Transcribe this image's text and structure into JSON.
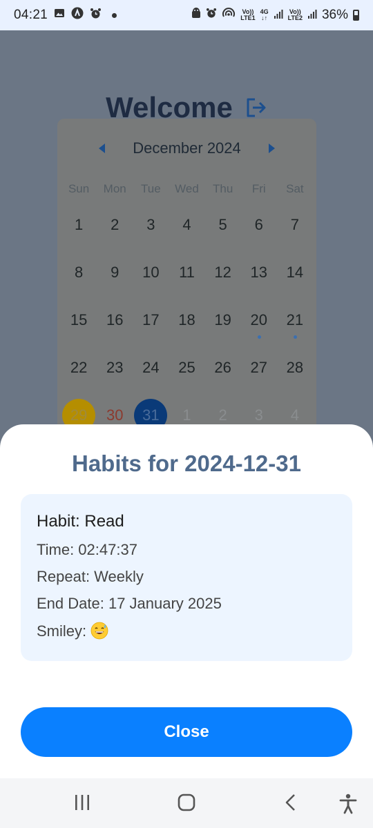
{
  "status_bar": {
    "time": "04:21",
    "volte1_label": "Vo))",
    "lte1_label": "LTE1",
    "network_4g_label": "4G",
    "volte2_label": "Vo))",
    "lte2_label": "LTE2",
    "battery_percent": "36%"
  },
  "header": {
    "title": "Welcome"
  },
  "calendar": {
    "month_label": "December 2024",
    "weekdays": [
      "Sun",
      "Mon",
      "Tue",
      "Wed",
      "Thu",
      "Fri",
      "Sat"
    ],
    "days": [
      {
        "label": "1"
      },
      {
        "label": "2"
      },
      {
        "label": "3"
      },
      {
        "label": "4"
      },
      {
        "label": "5"
      },
      {
        "label": "6"
      },
      {
        "label": "7"
      },
      {
        "label": "8"
      },
      {
        "label": "9"
      },
      {
        "label": "10"
      },
      {
        "label": "11"
      },
      {
        "label": "12"
      },
      {
        "label": "13"
      },
      {
        "label": "14"
      },
      {
        "label": "15"
      },
      {
        "label": "16"
      },
      {
        "label": "17"
      },
      {
        "label": "18"
      },
      {
        "label": "19"
      },
      {
        "label": "20",
        "marked": true
      },
      {
        "label": "21",
        "marked": true
      },
      {
        "label": "22"
      },
      {
        "label": "23"
      },
      {
        "label": "24"
      },
      {
        "label": "25"
      },
      {
        "label": "26"
      },
      {
        "label": "27"
      },
      {
        "label": "28"
      },
      {
        "label": "29",
        "state": "today"
      },
      {
        "label": "30",
        "state": "highlight"
      },
      {
        "label": "31",
        "state": "selected"
      },
      {
        "label": "1",
        "state": "other-month"
      },
      {
        "label": "2",
        "state": "other-month"
      },
      {
        "label": "3",
        "state": "other-month"
      },
      {
        "label": "4",
        "state": "other-month"
      }
    ],
    "colors": {
      "today_circle": "#b58e00",
      "selected_circle": "#0a3a78",
      "highlight_text": "#8c3a2e",
      "marker_dot": "#3b6fb0"
    }
  },
  "sheet": {
    "title": "Habits for 2024-12-31",
    "habit": {
      "name": "Habit: Read",
      "time": "Time: 02:47:37",
      "repeat": "Repeat: Weekly",
      "end_date": "End Date: 17 January 2025",
      "smiley_label": "Smiley:"
    },
    "close_label": "Close",
    "accent_color": "#0a80ff"
  },
  "nav_bar": {
    "icons": [
      "recents-icon",
      "home-icon",
      "back-icon",
      "accessibility-icon"
    ]
  }
}
